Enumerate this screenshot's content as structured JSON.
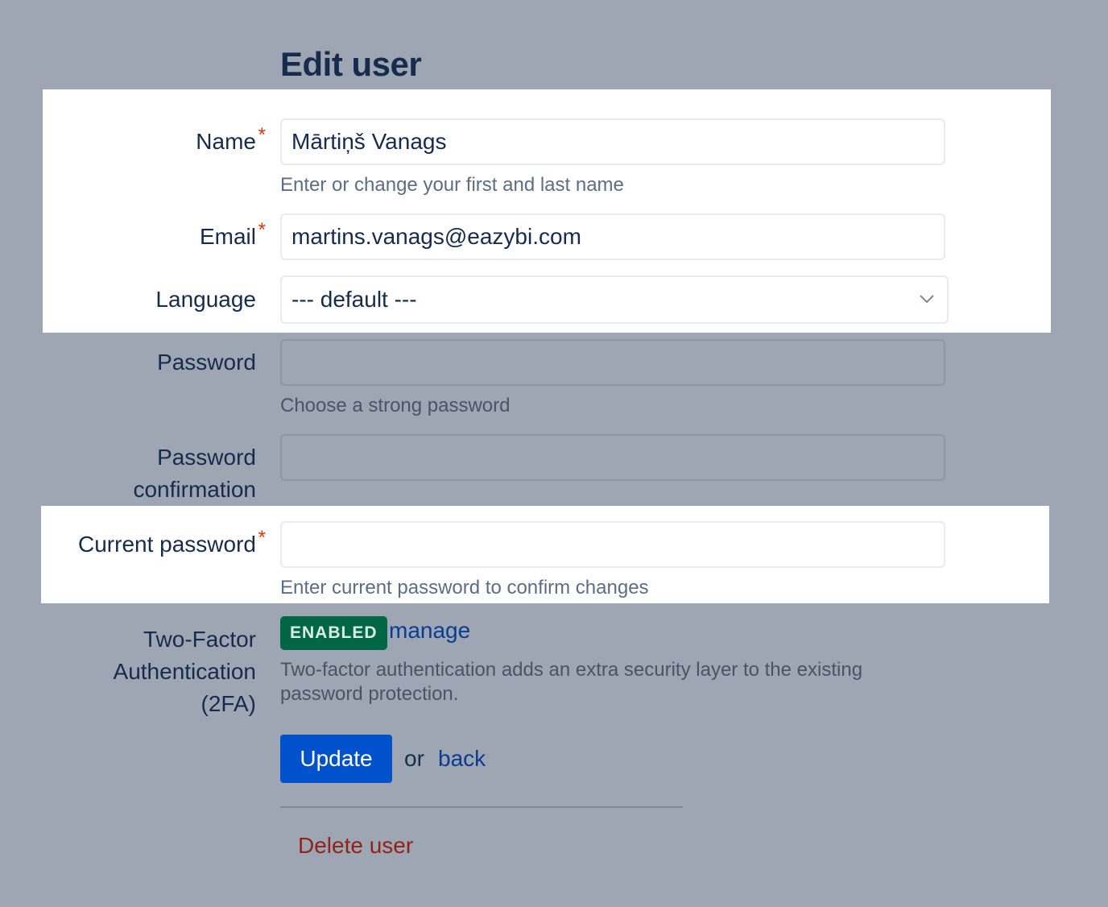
{
  "page": {
    "title": "Edit user"
  },
  "form": {
    "name": {
      "label": "Name",
      "required_mark": "*",
      "value": "Mārtiņš Vanags",
      "hint": "Enter or change your first and last name"
    },
    "email": {
      "label": "Email",
      "required_mark": "*",
      "value": "martins.vanags@eazybi.com"
    },
    "language": {
      "label": "Language",
      "selected": "--- default ---"
    },
    "password": {
      "label": "Password",
      "value": "",
      "hint": "Choose a strong password"
    },
    "password_confirmation": {
      "label_line1": "Password",
      "label_line2": "confirmation",
      "value": ""
    },
    "current_password": {
      "label": "Current password",
      "required_mark": "*",
      "value": "",
      "hint": "Enter current password to confirm changes"
    },
    "two_factor": {
      "label_line1": "Two-Factor",
      "label_line2": "Authentication",
      "label_line3": "(2FA)",
      "status_badge": "ENABLED",
      "manage_link": "manage",
      "hint_line1": "Two-factor authentication adds an extra security layer to the existing",
      "hint_line2": "password protection."
    }
  },
  "actions": {
    "update_label": "Update",
    "or_text": "or",
    "back_link": "back",
    "delete_link": "Delete user"
  },
  "colors": {
    "background": "#9ea5b3",
    "primary": "#0052cc",
    "badge": "#006644",
    "danger": "#8f2418",
    "required": "#de350b"
  },
  "icons": {
    "select": "chevron-down-icon"
  }
}
